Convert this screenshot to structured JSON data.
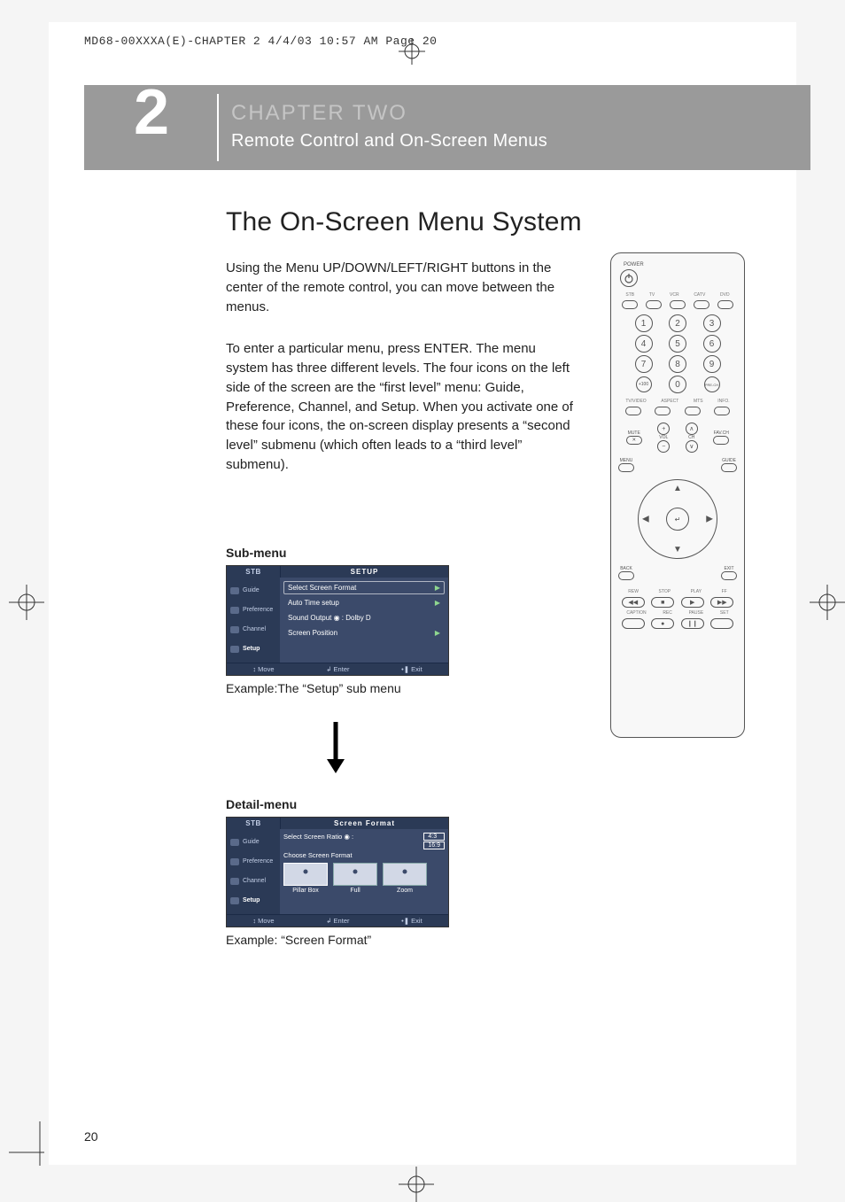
{
  "header_line": "MD68-00XXXA(E)-CHAPTER 2  4/4/03  10:57 AM  Page 20",
  "chapter": {
    "number": "2",
    "title": "CHAPTER TWO",
    "subtitle": "Remote Control and On-Screen Menus"
  },
  "section": {
    "title": "The On-Screen Menu System",
    "para1": "Using the Menu UP/DOWN/LEFT/RIGHT buttons in the center of the remote control, you can move between the menus.",
    "para2": "To enter a particular menu, press ENTER. The menu system has three different levels. The four icons on the left side of the screen are the “first level” menu: Guide, Preference, Channel, and Setup. When you activate one of these four icons, the on-screen display presents a “second level” submenu (which often leads to a “third level” submenu)."
  },
  "sub_label": "Sub-menu",
  "detail_label": "Detail-menu",
  "setup_ui": {
    "stb": "STB",
    "title": "SETUP",
    "side": [
      "Guide",
      "Preference",
      "Channel",
      "Setup"
    ],
    "rows": [
      {
        "label": "Select Screen Format",
        "arrow": true
      },
      {
        "label": "Auto Time setup",
        "arrow": true
      },
      {
        "label": "Sound Output   ◉ : Dolby D",
        "arrow": false
      },
      {
        "label": "Screen Position",
        "arrow": true
      }
    ],
    "foot": [
      "↕ Move",
      "↲ Enter",
      "•❚ Exit"
    ]
  },
  "setup_caption": "Example:The “Setup” sub menu",
  "sf_ui": {
    "stb": "STB",
    "title": "Screen Format",
    "side": [
      "Guide",
      "Preference",
      "Channel",
      "Setup"
    ],
    "row1_label": "Select  Screen Ratio  ◉ :",
    "row1_vals": [
      "4:3",
      "16:9"
    ],
    "row2_label": "Choose Screen Format",
    "thumbs": [
      "Pillar Box",
      "Full",
      "Zoom"
    ],
    "foot": [
      "↕ Move",
      "↲ Enter",
      "•❚ Exit"
    ]
  },
  "sf_caption": "Example: “Screen Format”",
  "remote": {
    "power": "POWER",
    "mode_labels": [
      "STB",
      "TV",
      "VCR",
      "CATV",
      "DVD"
    ],
    "digits": [
      "1",
      "2",
      "3",
      "4",
      "5",
      "6",
      "7",
      "8",
      "9"
    ],
    "bottom_digits": [
      "+100",
      "0",
      "PRE-CH"
    ],
    "fn1_labels": [
      "TV/VIDEO",
      "ASPECT",
      "MTS",
      "INFO."
    ],
    "mute": "MUTE",
    "vol": "VOL",
    "ch": "CH",
    "favch": "FAV.CH",
    "menu": "MENU",
    "guide": "GUIDE",
    "back": "BACK",
    "exit": "EXIT",
    "transport_labels": [
      "REW",
      "STOP",
      "PLAY",
      "FF"
    ],
    "transport_glyphs": [
      "◀◀",
      "■",
      "▶",
      "▶▶"
    ],
    "bottom_labels": [
      "CAPTION",
      "REC",
      "PAUSE",
      "SET"
    ],
    "rec_glyph": "●",
    "pause_glyph": "❙❙"
  },
  "page_number": "20"
}
